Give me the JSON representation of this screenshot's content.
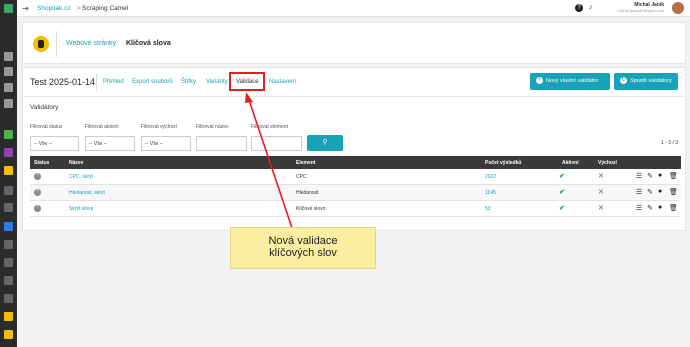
{
  "breadcrumb": {
    "root": "Shopitak.cz",
    "separator": ">",
    "current": "Scraping Camel"
  },
  "user": {
    "name": "Michal Janík",
    "email": "michal.janik@mingeo.com"
  },
  "header": {
    "tab_websites": "Webové stránky",
    "tab_keywords": "Klíčová slova"
  },
  "project": {
    "title": "Test 2025-01-14",
    "nav": [
      "Přehled",
      "Export souborů",
      "Štítky",
      "Varianty",
      "Validace",
      "Nastavení"
    ],
    "active_nav": "Validace",
    "btn_new_validator": "Nový vlastní validátor",
    "btn_run_validators": "Spustit validátory"
  },
  "section_title": "Validátory",
  "filters": {
    "status_label": "Filtrovat status",
    "status_value": "-- Vše --",
    "active_label": "Filtrovat aktivní",
    "active_value": "-- Vše --",
    "default_label": "Filtrovat výchozí",
    "default_value": "-- Vše --",
    "name_label": "Filtrovat název",
    "name_value": "",
    "element_label": "Filtrovat element",
    "element_value": ""
  },
  "pagination": "1 - 3 / 3",
  "table": {
    "headers": [
      "Status",
      "Název",
      "Element",
      "Počet výsledků",
      "Aktivní",
      "Výchozí"
    ],
    "rows": [
      {
        "name": "CPC, skrýt",
        "element": "CPC",
        "count": "2022",
        "active": true,
        "default": false
      },
      {
        "name": "Hledanost, skrýt",
        "element": "Hledanost",
        "count": "1145",
        "active": true,
        "default": false
      },
      {
        "name": "Skrýt slova",
        "element": "Klíčové slovo",
        "count": "53",
        "active": true,
        "default": false
      }
    ]
  },
  "annotation": {
    "line1": "Nová validace",
    "line2": "klíčových slov",
    "color": "#e02020"
  },
  "colors": {
    "accent": "#17a2b8",
    "sidebar": "#2b2b2b",
    "table_header": "#3a3a3a"
  }
}
